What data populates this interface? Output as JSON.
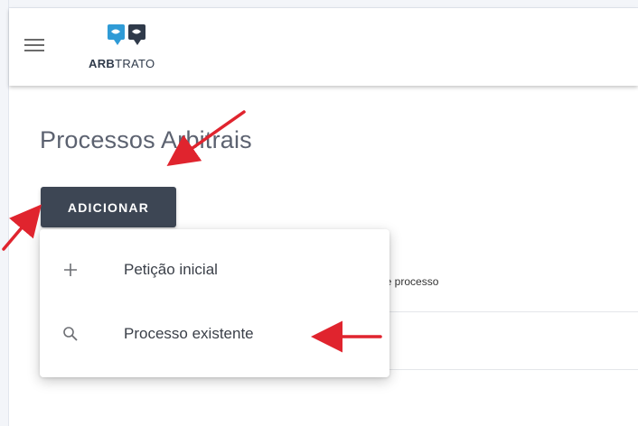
{
  "brand": {
    "name_bold": "ARB",
    "name_rest": "TRATO",
    "colors": {
      "primary": "#2f9bd6",
      "dark": "#2f3a4a"
    }
  },
  "appbar": {
    "menu_icon": "hamburger-icon"
  },
  "page": {
    "title": "Processos Arbitrais"
  },
  "toolbar": {
    "add_label": "ADICIONAR",
    "add_color": "#3d4654"
  },
  "table": {
    "column_partial": "de processo"
  },
  "add_menu": {
    "items": [
      {
        "label": "Petição inicial",
        "icon": "plus-icon"
      },
      {
        "label": "Processo existente",
        "icon": "search-icon"
      }
    ]
  },
  "annotation": {
    "arrow_color": "#e0242e"
  }
}
